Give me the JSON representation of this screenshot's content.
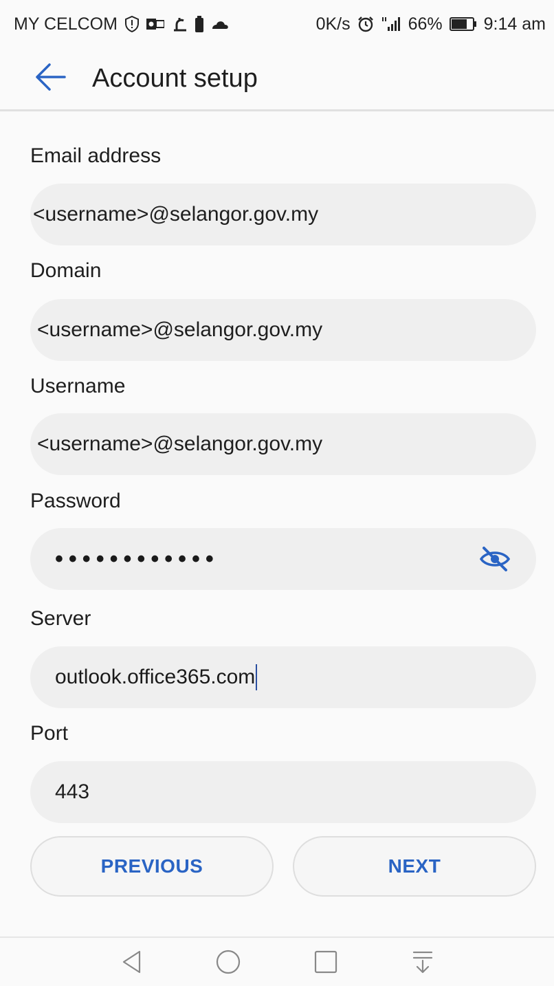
{
  "status_bar": {
    "carrier": "MY CELCOM",
    "speed": "0K/s",
    "battery": "66%",
    "time": "9:14 am",
    "icons": [
      "shield-icon",
      "outlook-icon",
      "notification-icon",
      "battery-saver-icon",
      "cloud-icon",
      "alarm-icon",
      "signal-icon",
      "battery-icon"
    ]
  },
  "app_bar": {
    "title": "Account setup",
    "back_icon": "back-arrow-icon"
  },
  "form": {
    "email": {
      "label": "Email address",
      "value": "<username>@selangor.gov.my"
    },
    "domain": {
      "label": "Domain",
      "value": "<username>@selangor.gov.my"
    },
    "username": {
      "label": "Username",
      "value": "<username>@selangor.gov.my"
    },
    "password": {
      "label": "Password",
      "value": "••••••••••••",
      "toggle_icon": "eye-off-icon"
    },
    "server": {
      "label": "Server",
      "value": "outlook.office365.com"
    },
    "port": {
      "label": "Port",
      "value": "443"
    }
  },
  "buttons": {
    "previous": "PREVIOUS",
    "next": "NEXT"
  },
  "nav_bar": {
    "icons": [
      "back-triangle-icon",
      "home-circle-icon",
      "recents-square-icon",
      "notification-pull-icon"
    ]
  },
  "colors": {
    "accent": "#2a64c4",
    "field_bg": "#efefef",
    "page_bg": "#fafafa"
  }
}
